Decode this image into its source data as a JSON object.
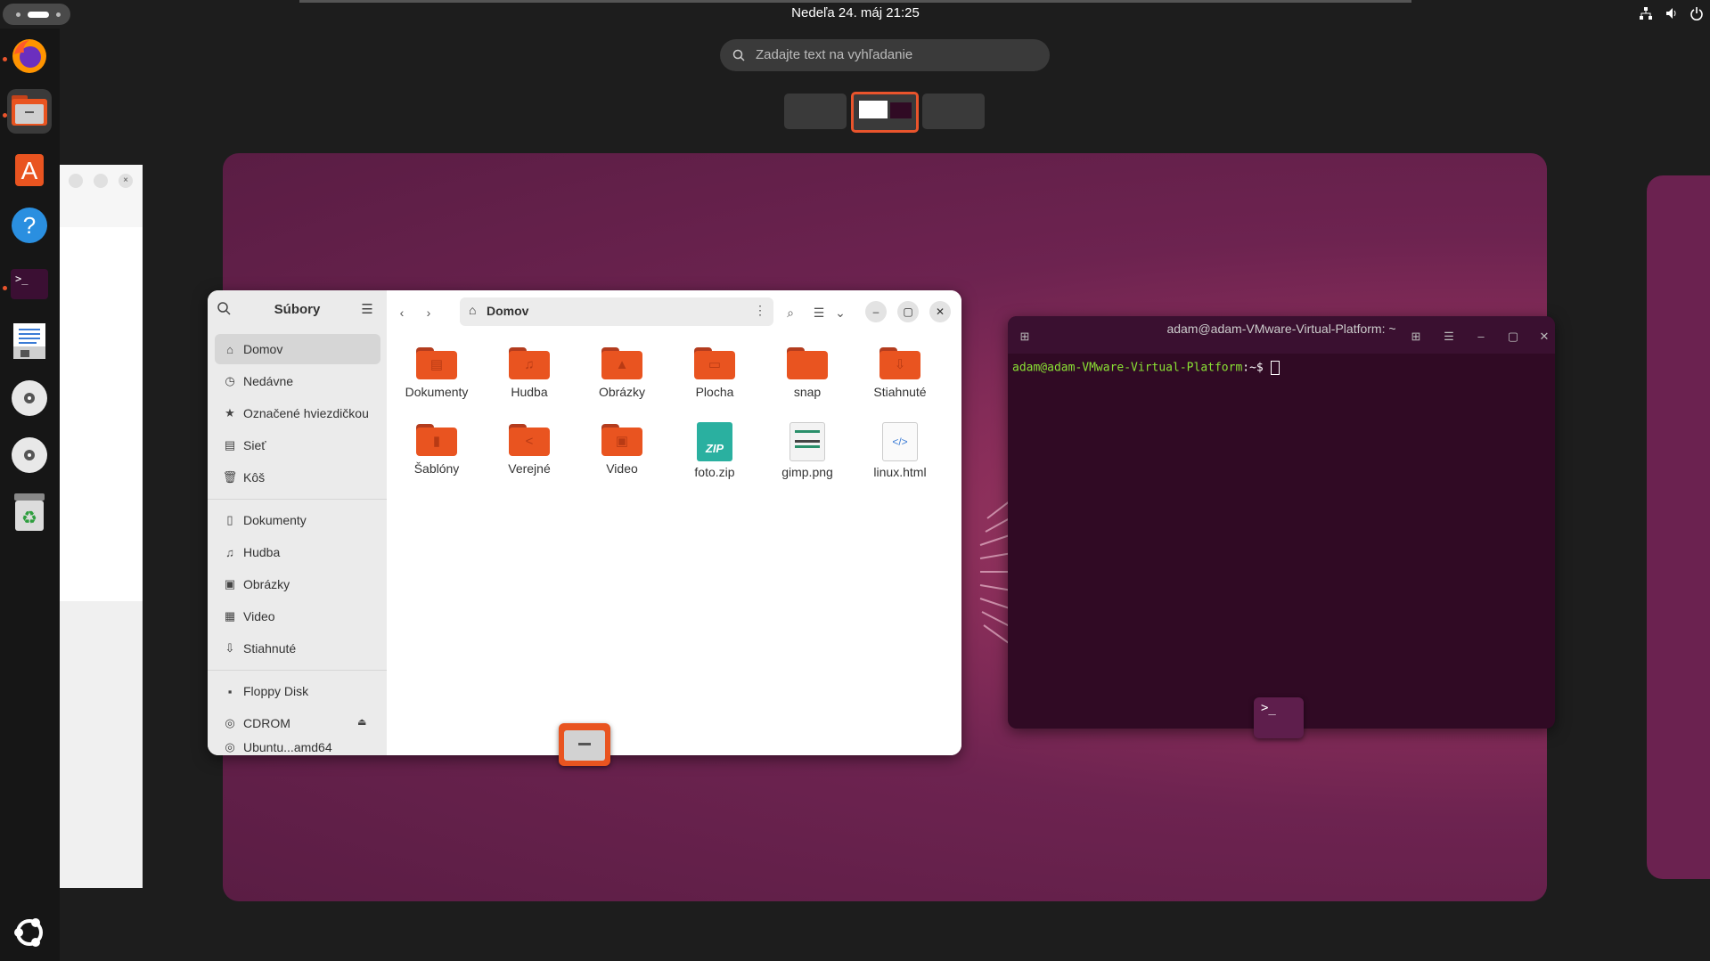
{
  "topbar": {
    "clock": "Nedeľa 24. máj  21:25",
    "icons": [
      "network-icon",
      "volume-icon",
      "power-icon"
    ]
  },
  "search": {
    "placeholder": "Zadajte text na vyhľadanie"
  },
  "dock": {
    "apps": [
      "firefox-icon",
      "files-icon",
      "app-center-icon",
      "help-icon",
      "terminal-icon",
      "writer-icon",
      "disc-icon",
      "disc-icon",
      "trash-icon"
    ],
    "running": [
      "firefox",
      "files",
      "terminal"
    ]
  },
  "files": {
    "sidebar_title": "Súbory",
    "places": [
      {
        "label": "Domov",
        "icon": "home-icon",
        "active": true
      },
      {
        "label": "Nedávne",
        "icon": "clock-icon"
      },
      {
        "label": "Označené hviezdičkou",
        "icon": "star-icon"
      },
      {
        "label": "Sieť",
        "icon": "network-icon"
      },
      {
        "label": "Kôš",
        "icon": "trash-icon"
      }
    ],
    "bookmarks": [
      {
        "label": "Dokumenty",
        "icon": "document-icon"
      },
      {
        "label": "Hudba",
        "icon": "music-icon"
      },
      {
        "label": "Obrázky",
        "icon": "picture-icon"
      },
      {
        "label": "Video",
        "icon": "video-icon"
      },
      {
        "label": "Stiahnuté",
        "icon": "download-icon"
      }
    ],
    "devices": [
      {
        "label": "Floppy Disk",
        "icon": "floppy-icon"
      },
      {
        "label": "CDROM",
        "icon": "cdrom-icon"
      },
      {
        "label": "Ubuntu...amd64",
        "icon": "cdrom-icon"
      }
    ],
    "path": "Domov",
    "items": [
      {
        "name": "Dokumenty",
        "type": "folder",
        "glyph": "▤"
      },
      {
        "name": "Hudba",
        "type": "folder",
        "glyph": "♫"
      },
      {
        "name": "Obrázky",
        "type": "folder",
        "glyph": "▲"
      },
      {
        "name": "Plocha",
        "type": "folder",
        "glyph": "▭"
      },
      {
        "name": "snap",
        "type": "folder",
        "glyph": ""
      },
      {
        "name": "Stiahnuté",
        "type": "folder",
        "glyph": "⇩"
      },
      {
        "name": "Šablóny",
        "type": "folder",
        "glyph": "▮"
      },
      {
        "name": "Verejné",
        "type": "folder",
        "glyph": "<"
      },
      {
        "name": "Video",
        "type": "folder",
        "glyph": "▣"
      },
      {
        "name": "foto.zip",
        "type": "zip",
        "glyph": "ZIP"
      },
      {
        "name": "gimp.png",
        "type": "image",
        "glyph": ""
      },
      {
        "name": "linux.html",
        "type": "html",
        "glyph": "</>"
      }
    ]
  },
  "terminal": {
    "title": "adam@adam-VMware-Virtual-Platform: ~",
    "prompt_user": "adam@adam-VMware-Virtual-Platform",
    "prompt_tail": ":~$ ",
    "drag_glyph": ">_"
  },
  "colors": {
    "accent": "#e95420",
    "terminal_bg": "#300a24",
    "prompt": "#8ae234"
  }
}
